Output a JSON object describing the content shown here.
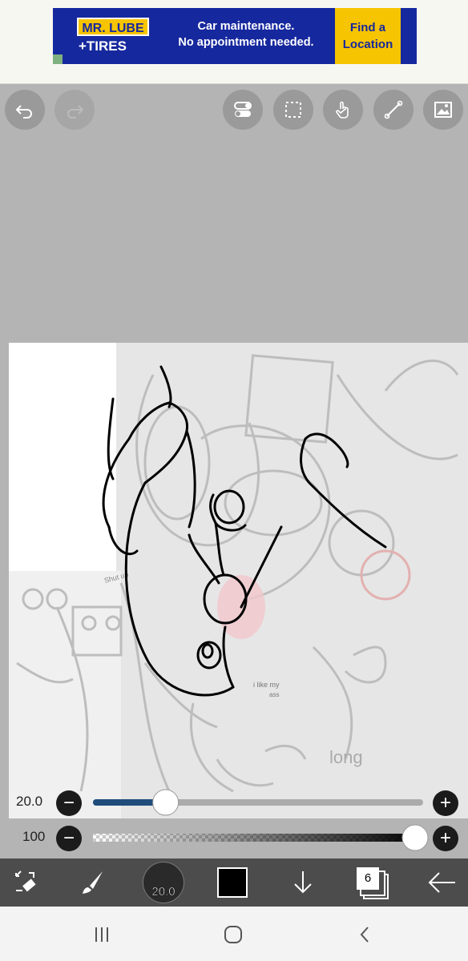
{
  "ad": {
    "brand_line1": "MR. LUBE",
    "brand_line2": "+TIRES",
    "message_line1": "Car maintenance.",
    "message_line2": "No appointment needed.",
    "cta_line1": "Find a",
    "cta_line2": "Location"
  },
  "canvas_annotations": {
    "note_small": "i like my",
    "note_small2": "ass",
    "doodle_word": "long",
    "doodle_caption": "Shut up"
  },
  "brush": {
    "size_label": "20.0",
    "size_fraction": 0.22,
    "opacity_label": "100",
    "opacity_fraction": 1.0
  },
  "toolbar": {
    "brush_size_badge": "20.0",
    "layer_count": "6",
    "current_color": "#000000"
  },
  "colors": {
    "accent": "#1f4d7a",
    "toolbar_bg": "#4c4c4c"
  },
  "icons": {
    "top": [
      "undo-icon",
      "redo-icon",
      "toggle-icon",
      "selection-icon",
      "hand-icon",
      "ruler-icon",
      "image-icon"
    ],
    "bottom": [
      "transform-icon",
      "brush-icon",
      "brush-size-icon",
      "color-swatch-icon",
      "download-icon",
      "layers-icon",
      "back-arrow-icon"
    ]
  }
}
